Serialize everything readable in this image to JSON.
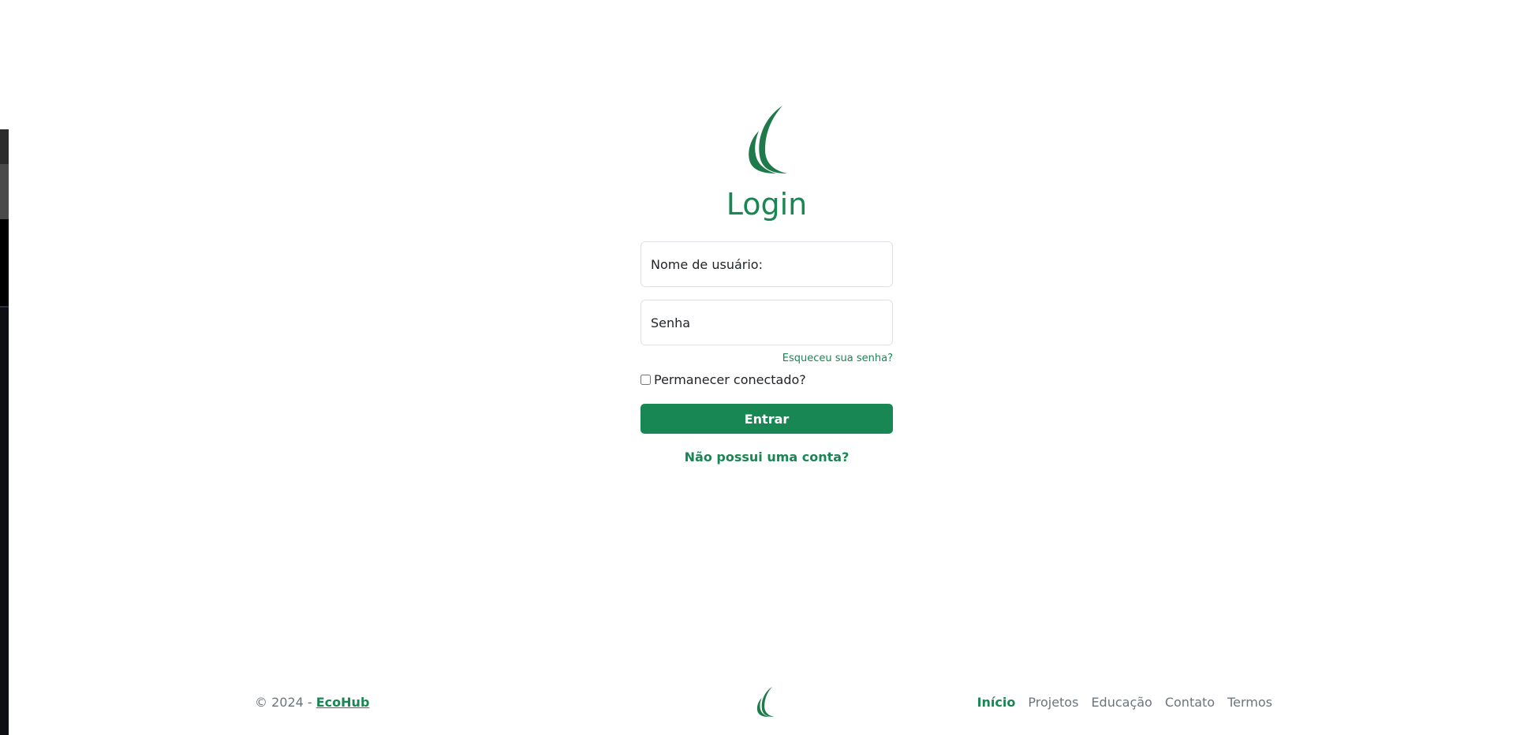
{
  "login": {
    "title": "Login",
    "username_placeholder": "Nome de usuário:",
    "password_placeholder": "Senha",
    "forgot_link": "Esqueceu sua senha?",
    "remember_label": "Permanecer conectado?",
    "submit_label": "Entrar",
    "signup_link": "Não possui uma conta?"
  },
  "footer": {
    "copyright_prefix": "© 2024 - ",
    "brand": "EcoHub",
    "nav": [
      {
        "label": "Início",
        "active": true
      },
      {
        "label": "Projetos"
      },
      {
        "label": "Educação"
      },
      {
        "label": "Contato"
      },
      {
        "label": "Termos"
      }
    ]
  },
  "colors": {
    "primary": "#198754",
    "muted": "#6c757d",
    "border": "#dee2e6"
  },
  "icons": {
    "logo": "ecohub-leaf-logo",
    "footer_logo": "ecohub-leaf-logo"
  }
}
